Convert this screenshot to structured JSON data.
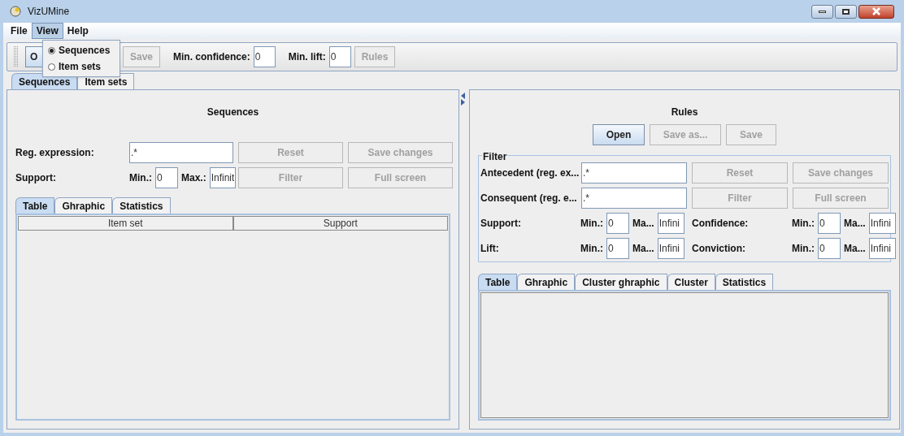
{
  "window": {
    "title": "VizUMine"
  },
  "menu": [
    {
      "label": "File",
      "selected": false
    },
    {
      "label": "View",
      "selected": true
    },
    {
      "label": "Help",
      "selected": false
    }
  ],
  "view_menu": [
    {
      "label": "Sequences",
      "selected": true
    },
    {
      "label": "Item sets",
      "selected": false
    }
  ],
  "toolbar": {
    "buttons": [
      {
        "label": "O",
        "disabled": false
      },
      {
        "label": "Save",
        "disabled": true
      }
    ],
    "min_confidence": {
      "label": "Min. confidence:",
      "value": "0"
    },
    "min_lift": {
      "label": "Min. lift:",
      "value": "0"
    },
    "rules_button": {
      "label": "Rules",
      "disabled": true
    }
  },
  "main_tabs": [
    {
      "label": "Sequences",
      "selected": true
    },
    {
      "label": "Item sets",
      "selected": false
    }
  ],
  "sequences": {
    "title": "Sequences",
    "regex": {
      "label": "Reg. expression:",
      "value": ".*"
    },
    "support": {
      "label": "Support:",
      "min_label": "Min.:",
      "min_value": "0",
      "max_label": "Max.:",
      "max_value": "Infinit"
    },
    "buttons": [
      {
        "label": "Reset",
        "disabled": true
      },
      {
        "label": "Save changes",
        "disabled": true
      },
      {
        "label": "Filter",
        "disabled": true
      },
      {
        "label": "Full screen",
        "disabled": true
      }
    ],
    "tabs": [
      {
        "label": "Table",
        "selected": true
      },
      {
        "label": "Ghraphic",
        "selected": false
      },
      {
        "label": "Statistics",
        "selected": false
      }
    ],
    "table": {
      "columns": [
        "Item set",
        "Support"
      ]
    }
  },
  "rules": {
    "title": "Rules",
    "buttons": [
      {
        "label": "Open",
        "disabled": false
      },
      {
        "label": "Save as...",
        "disabled": true
      },
      {
        "label": "Save",
        "disabled": true
      }
    ],
    "filter": {
      "legend": "Filter",
      "antecedent": {
        "label": "Antecedent (reg. ex...",
        "value": ".*"
      },
      "consequent": {
        "label": "Consequent (reg. e...",
        "value": ".*"
      },
      "buttons": [
        {
          "label": "Reset",
          "disabled": true
        },
        {
          "label": "Save changes",
          "disabled": true
        },
        {
          "label": "Filter",
          "disabled": true
        },
        {
          "label": "Full screen",
          "disabled": true
        }
      ],
      "ranges": [
        {
          "label": "Support:",
          "min_label": "Min.:",
          "min_value": "0",
          "max_label": "Ma...",
          "max_value": "Infini"
        },
        {
          "label": "Confidence:",
          "min_label": "Min.:",
          "min_value": "0",
          "max_label": "Ma...",
          "max_value": "Infini"
        },
        {
          "label": "Lift:",
          "min_label": "Min.:",
          "min_value": "0",
          "max_label": "Ma...",
          "max_value": "Infini"
        },
        {
          "label": "Conviction:",
          "min_label": "Min.:",
          "min_value": "0",
          "max_label": "Ma...",
          "max_value": "Infini"
        }
      ]
    },
    "tabs": [
      {
        "label": "Table",
        "selected": true
      },
      {
        "label": "Ghraphic",
        "selected": false
      },
      {
        "label": "Cluster ghraphic",
        "selected": false
      },
      {
        "label": "Cluster",
        "selected": false
      },
      {
        "label": "Statistics",
        "selected": false
      }
    ]
  }
}
